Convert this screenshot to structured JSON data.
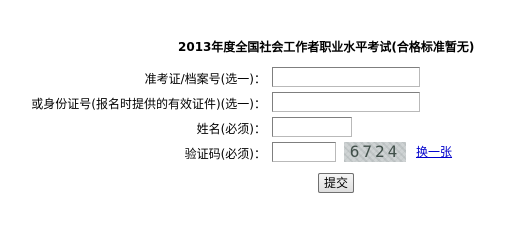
{
  "form": {
    "title": "2013年度全国社会工作者职业水平考试(合格标准暂无)",
    "ticket_label": "准考证/档案号(选一)：",
    "ticket_value": "",
    "id_label": "或身份证号(报名时提供的有效证件)(选一)：",
    "id_value": "",
    "name_label": "姓名(必须)：",
    "name_value": "",
    "captcha_label": "验证码(必须)：",
    "captcha_value": "",
    "captcha_image_text": "6724",
    "refresh_link": "换一张",
    "submit_label": "提交"
  }
}
